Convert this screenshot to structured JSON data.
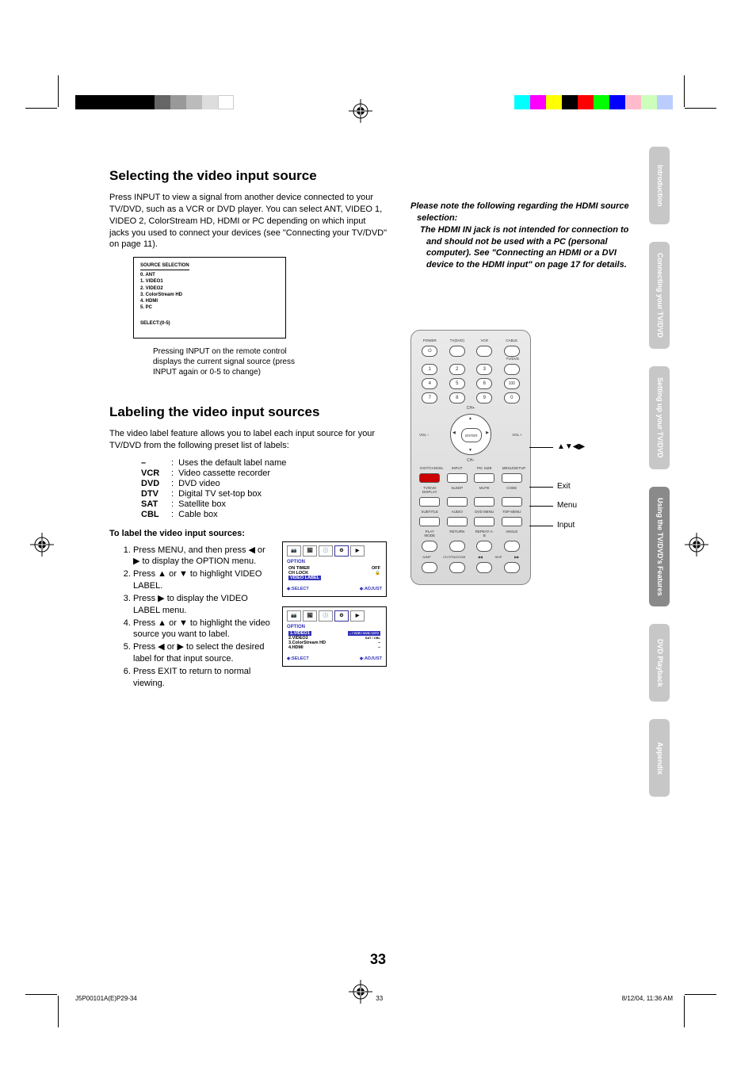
{
  "page_number": "33",
  "footer": {
    "file": "J5P00101A(E)P29-34",
    "page": "33",
    "timestamp": "8/12/04, 11:36 AM"
  },
  "sidebar": {
    "tabs": [
      "Introduction",
      "Connecting your TV/DVD",
      "Setting up your TV/DVD",
      "Using the TV/DVD's Features",
      "DVD Playback",
      "Appendix"
    ]
  },
  "section1": {
    "title": "Selecting the video input source",
    "body": "Press INPUT to view a signal from another device connected to your TV/DVD, such as a VCR or DVD player. You can select ANT, VIDEO 1, VIDEO 2, ColorStream HD, HDMI or PC depending on which input jacks you used to connect your devices (see \"Connecting your TV/DVD\" on page 11).",
    "osd": {
      "title": "SOURCE SELECTION",
      "items": [
        "0. ANT",
        "1. VIDEO1",
        "2. VIDEO2",
        "3. ColorStream HD",
        "4. HDMI",
        "5. PC"
      ],
      "hint": "SELECT:(0-5)"
    },
    "caption": "Pressing INPUT on the remote control displays the current signal source (press INPUT again or 0-5 to change)"
  },
  "note": {
    "lead": "Please note the following regarding the HDMI source selection:",
    "body": "The HDMI IN jack is not intended for connection to and should not be used with a PC (personal computer). See \"Connecting an HDMI or a DVI device to the HDMI input\" on page 17 for details."
  },
  "section2": {
    "title": "Labeling the video input sources",
    "body": "The video label feature allows you to label each input source for your TV/DVD from the following preset list of labels:",
    "labels": [
      {
        "k": "–",
        "v": "Uses the default label name"
      },
      {
        "k": "VCR",
        "v": "Video cassette recorder"
      },
      {
        "k": "DVD",
        "v": "DVD video"
      },
      {
        "k": "DTV",
        "v": "Digital TV set-top box"
      },
      {
        "k": "SAT",
        "v": "Satellite box"
      },
      {
        "k": "CBL",
        "v": "Cable box"
      }
    ],
    "steps_title": "To label the video input sources:",
    "steps": [
      "Press MENU, and then press ◀ or ▶ to display the OPTION menu.",
      "Press ▲ or ▼ to highlight VIDEO LABEL.",
      "Press ▶ to display the VIDEO LABEL menu.",
      "Press ▲ or ▼ to highlight the video source you want to label.",
      "Press ◀ or ▶ to select the desired label for that input source.",
      "Press EXIT to return to normal viewing."
    ]
  },
  "option_menu1": {
    "title": "OPTION",
    "rows": [
      {
        "l": "ON TIMER",
        "r": "OFF"
      },
      {
        "l": "CH LOCK",
        "r": "🔒"
      },
      {
        "l": "VIDEO LABEL",
        "r": "",
        "hl": true
      }
    ],
    "foot_l": "◆:SELECT",
    "foot_r": "◆:ADJUST"
  },
  "option_menu2": {
    "title": "OPTION",
    "rows": [
      {
        "l": "1.VIDEO1",
        "r": "– / VCR / DVD / DTV",
        "hl": true
      },
      {
        "l": "2.VIDEO2",
        "r": "    SAT / CBL"
      },
      {
        "l": "3.ColorStream HD",
        "r": "–"
      },
      {
        "l": "4.HDMI",
        "r": "–"
      }
    ],
    "foot_l": "◆:SELECT",
    "foot_r": "◆:ADJUST"
  },
  "remote": {
    "top_labels": [
      "POWER",
      "TV(DVD)",
      "VCR",
      "CABLE"
    ],
    "tvdvd": "TV/DVD",
    "nums": [
      "1",
      "2",
      "3",
      "",
      "4",
      "5",
      "6",
      "100",
      "7",
      "8",
      "9",
      "0"
    ],
    "ch_plus": "CH+",
    "ch_minus": "CH–",
    "vol_minus": "VOL –",
    "vol_plus": "VOL +",
    "enter": "ENTER",
    "row_a": [
      "EXIT/CANCEL",
      "INPUT",
      "PIC SIZE",
      "MENU/SETUP"
    ],
    "row_b": [
      "TV/DVD DISPLAY",
      "SLEEP",
      "MUTE",
      "CODE"
    ],
    "row_c": [
      "SUBTITLE",
      "AUDIO",
      "DVD MENU",
      "TOP MENU"
    ],
    "row_d": [
      "PLAY MODE",
      "RETURN",
      "REPEAT A-B",
      "ANGLE"
    ],
    "row_e": [
      "JUMP",
      "CH RTN/ZOOM",
      "◀◀",
      "SKIP",
      "▶▶"
    ],
    "callouts": {
      "arrows": "▲▼◀▶",
      "exit": "Exit",
      "menu": "Menu",
      "input": "Input"
    }
  },
  "color_bars_left": [
    "#000",
    "#000",
    "#000",
    "#000",
    "#000",
    "#666",
    "#999",
    "#bbb",
    "#ddd",
    "#fff"
  ],
  "color_bars_right": [
    "#0ff",
    "#f0f",
    "#ff0",
    "#000",
    "#f00",
    "#0f0",
    "#00f",
    "#fbb",
    "#bfb",
    "#bbf"
  ]
}
